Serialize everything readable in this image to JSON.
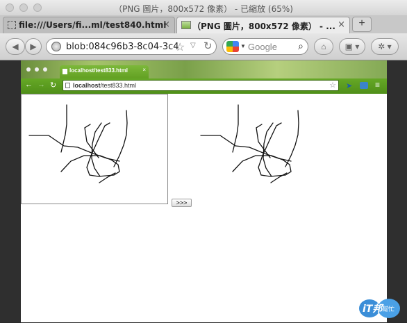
{
  "window": {
    "title": "（PNG 圖片，800x572 像素） - 已縮放 (65%)"
  },
  "tabs": [
    {
      "label": "file:///Users/fi...ml/test840.html",
      "close": "×"
    },
    {
      "label": "（PNG 圖片，800x572 像素） - ...",
      "close": "×"
    }
  ],
  "newtab": "+",
  "nav": {
    "back": "◀",
    "forward": "▶",
    "url": "blob:084c96b3-8c04-3c4",
    "search_placeholder": "Google"
  },
  "inner": {
    "tab_label": "localhost/test833.html",
    "url_host": "localhost",
    "url_path": "/test833.html",
    "button_label": ">>>"
  },
  "badge": {
    "text": "iT邦",
    "sub": "幫忙"
  },
  "colors": {
    "titlebar": "#d5d5d5",
    "chrome_green": "#4f8f19",
    "page_bg": "#ffffff"
  }
}
